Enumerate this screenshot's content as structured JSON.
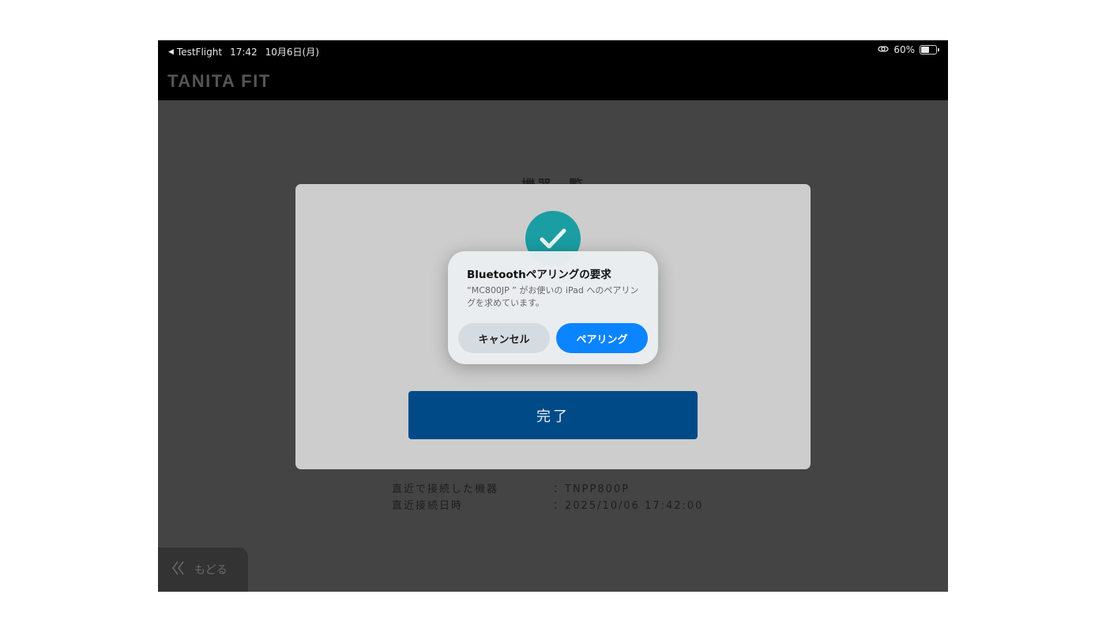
{
  "status_bar": {
    "back_app": "TestFlight",
    "time": "17:42",
    "date": "10月6日(月)",
    "battery": "60%",
    "battery_level": 0.6
  },
  "app": {
    "brand": "TANITA FIT"
  },
  "page": {
    "title": "機器一覧",
    "done_label": "完了",
    "back_label": "もどる",
    "recent": [
      {
        "label": "直近で接続した機器",
        "value": "：TNPP800P"
      },
      {
        "label": "直近接続日時",
        "value": "：2025/10/06 17:42:00"
      }
    ]
  },
  "alert": {
    "title": "Bluetoothペアリングの要求",
    "message": "“MC800JP ” がお使いの iPad へのペアリングを求めています。",
    "cancel_label": "キャンセル",
    "pair_label": "ペアリング"
  },
  "colors": {
    "accent_blue": "#0a84ff",
    "done_button": "#004b87",
    "check_teal": "#1a9ea3"
  }
}
